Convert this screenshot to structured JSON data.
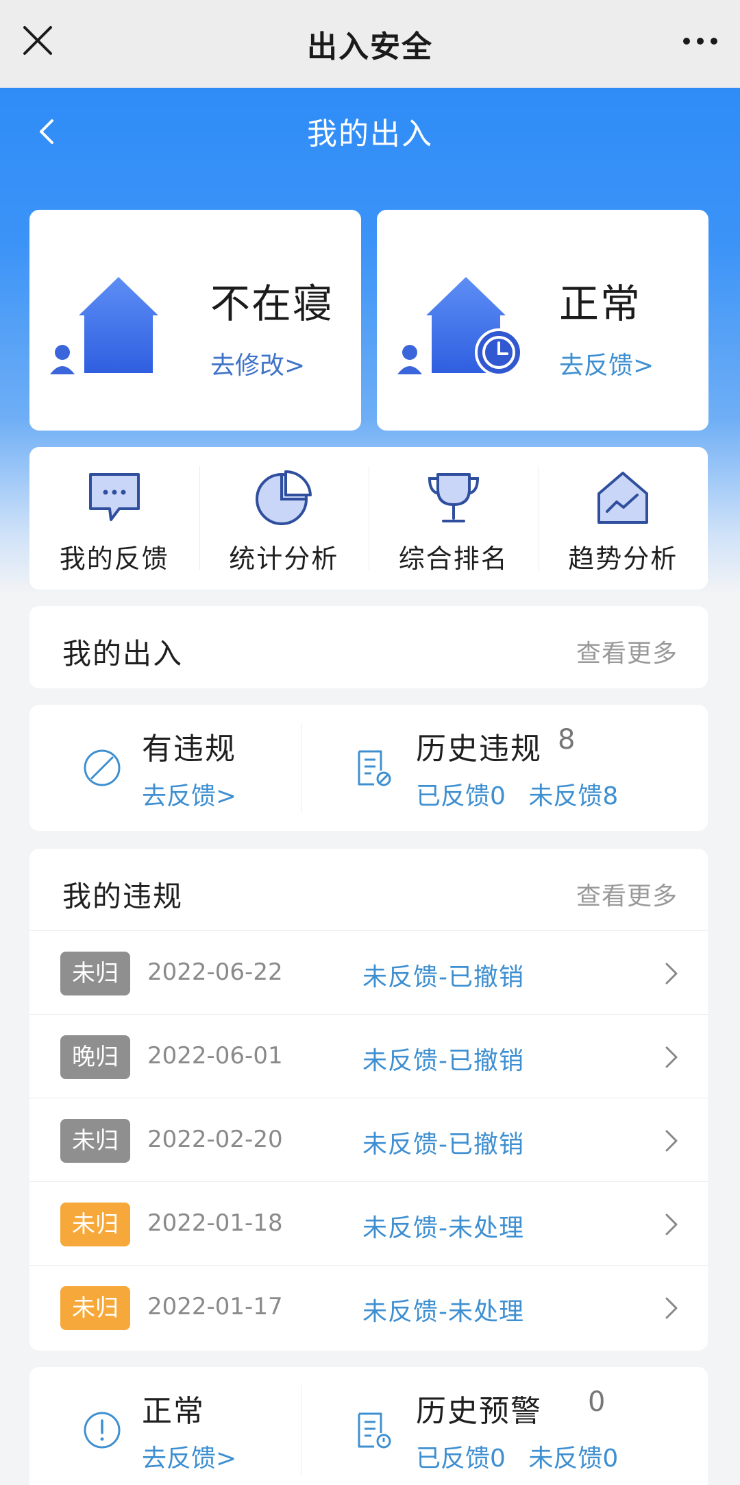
{
  "app": {
    "title": "出入安全"
  },
  "nav": {
    "title": "我的出入"
  },
  "status_cards": [
    {
      "status": "不在寝",
      "link": "去修改>"
    },
    {
      "status": "正常",
      "link": "去反馈>"
    }
  ],
  "quick_actions": [
    {
      "label": "我的反馈",
      "icon": "chat-bubble-icon"
    },
    {
      "label": "统计分析",
      "icon": "pie-chart-icon"
    },
    {
      "label": "综合排名",
      "icon": "trophy-icon"
    },
    {
      "label": "趋势分析",
      "icon": "trend-house-icon"
    }
  ],
  "my_access": {
    "title": "我的出入",
    "more": "查看更多"
  },
  "violation_summary": {
    "current": {
      "title": "有违规",
      "link": "去反馈>"
    },
    "history": {
      "title": "历史违规",
      "count": "8",
      "feedback": "已反馈0",
      "unfeedback": "未反馈8"
    }
  },
  "my_violations": {
    "title": "我的违规",
    "more": "查看更多",
    "rows": [
      {
        "tag": "未归",
        "tag_color": "#8f8f8f",
        "date": "2022-06-22",
        "status": "未反馈-已撤销"
      },
      {
        "tag": "晚归",
        "tag_color": "#8f8f8f",
        "date": "2022-06-01",
        "status": "未反馈-已撤销"
      },
      {
        "tag": "未归",
        "tag_color": "#8f8f8f",
        "date": "2022-02-20",
        "status": "未反馈-已撤销"
      },
      {
        "tag": "未归",
        "tag_color": "#f6a93a",
        "date": "2022-01-18",
        "status": "未反馈-未处理"
      },
      {
        "tag": "未归",
        "tag_color": "#f6a93a",
        "date": "2022-01-17",
        "status": "未反馈-未处理"
      }
    ]
  },
  "warning_summary": {
    "current": {
      "title": "正常",
      "link": "去反馈>"
    },
    "history": {
      "title": "历史预警",
      "count": "0",
      "feedback": "已反馈0",
      "unfeedback": "未反馈0"
    }
  },
  "colors": {
    "primary_blue": "#2f8cf7",
    "link_blue": "#3e8fd1",
    "tag_gray": "#8f8f8f",
    "tag_orange": "#f6a93a"
  }
}
